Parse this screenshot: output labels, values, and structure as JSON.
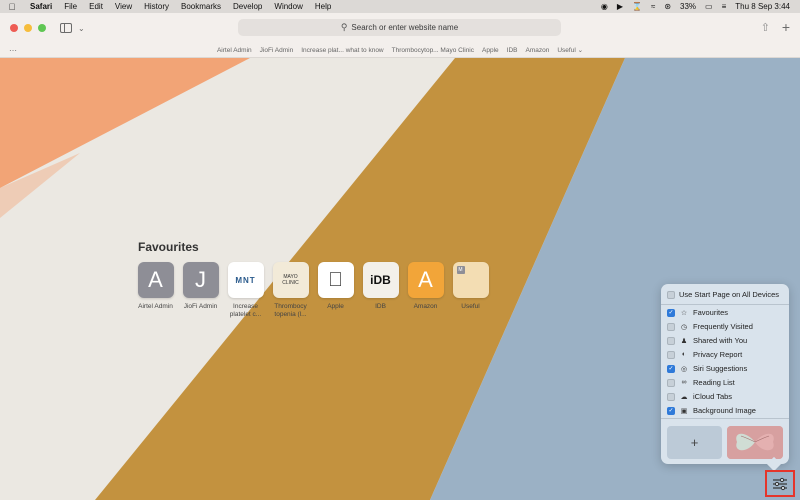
{
  "menubar": {
    "items": [
      "Safari",
      "File",
      "Edit",
      "View",
      "History",
      "Bookmarks",
      "Develop",
      "Window",
      "Help"
    ],
    "battery": "33%",
    "clock": "Thu 8 Sep  3:44"
  },
  "toolbar": {
    "address_placeholder": "Search or enter website name"
  },
  "favourites_bar": {
    "items": [
      "Airtel Admin",
      "JioFi Admin",
      "Increase plat... what to know",
      "Thrombocytop... Mayo Clinic",
      "Apple",
      "IDB",
      "Amazon",
      "Useful"
    ]
  },
  "start_page": {
    "title": "Favourites",
    "items": [
      {
        "label": "Airtel Admin",
        "letter": "A",
        "color": "#8e8e96"
      },
      {
        "label": "JioFi Admin",
        "letter": "J",
        "color": "#8e8e96"
      },
      {
        "label": "Increase platelet c...",
        "tile_text": "MNT",
        "color": "#ffffff"
      },
      {
        "label": "Thrombocy topenia (l...",
        "tile_text": "MAYO CLINIC",
        "color": "#f2ead8"
      },
      {
        "label": "Apple",
        "tile_text": "",
        "color": "#ffffff"
      },
      {
        "label": "IDB",
        "tile_text": "iDB",
        "color": "#f3f0ea"
      },
      {
        "label": "Amazon",
        "letter": "A",
        "color": "#f2a539"
      },
      {
        "label": "Useful",
        "tile_text": "M",
        "color": "#f3ddb3"
      }
    ]
  },
  "customize": {
    "use_start_page": "Use Start Page on All Devices",
    "options": [
      {
        "label": "Favourites",
        "checked": true,
        "icon": "star-icon"
      },
      {
        "label": "Frequently Visited",
        "checked": false,
        "icon": "clock-icon"
      },
      {
        "label": "Shared with You",
        "checked": false,
        "icon": "people-icon"
      },
      {
        "label": "Privacy Report",
        "checked": false,
        "icon": "shield-icon"
      },
      {
        "label": "Siri Suggestions",
        "checked": true,
        "icon": "siri-icon"
      },
      {
        "label": "Reading List",
        "checked": false,
        "icon": "glasses-icon"
      },
      {
        "label": "iCloud Tabs",
        "checked": false,
        "icon": "cloud-icon"
      },
      {
        "label": "Background Image",
        "checked": true,
        "icon": "image-icon"
      }
    ]
  },
  "colors": {
    "accent": "#2f7ad9",
    "highlight": "#e5352a"
  }
}
